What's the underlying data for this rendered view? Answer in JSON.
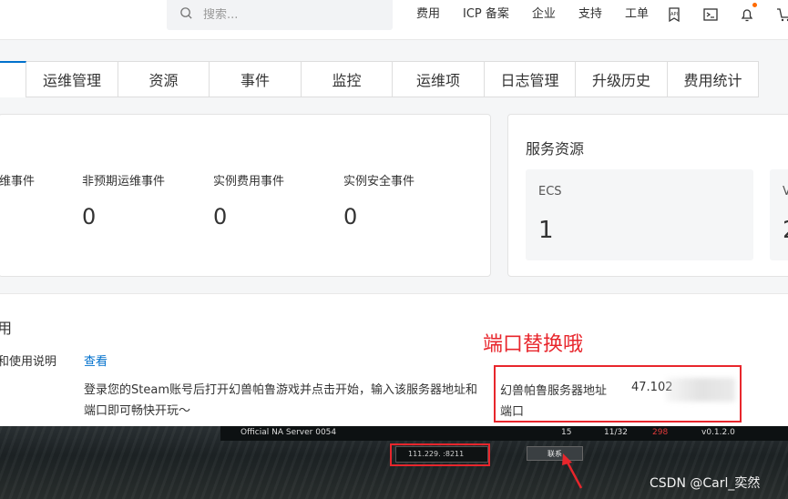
{
  "header": {
    "search_placeholder": "搜索...",
    "nav": [
      "费用",
      "ICP 备案",
      "企业",
      "支持",
      "工单"
    ],
    "icons": [
      "api-icon",
      "terminal-icon",
      "bell-icon",
      "cart-icon"
    ]
  },
  "tabs": [
    "运维管理",
    "资源",
    "事件",
    "监控",
    "运维项",
    "日志管理",
    "升级历史",
    "费用统计"
  ],
  "events": {
    "items": [
      {
        "label": "维事件",
        "value": ""
      },
      {
        "label": "非预期运维事件",
        "value": "0"
      },
      {
        "label": "实例费用事件",
        "value": "0"
      },
      {
        "label": "实例安全事件",
        "value": "0"
      }
    ]
  },
  "resources": {
    "title": "服务资源",
    "boxes": [
      {
        "label": "ECS",
        "value": "1"
      },
      {
        "label": "V",
        "value": "2"
      }
    ]
  },
  "usage": {
    "title": "用",
    "row_label": "和使用说明",
    "link": "查看",
    "link2": "]",
    "description": "登录您的Steam账号后打开幻兽帕鲁游戏并点击开始，输入该服务器地址和端口即可畅快开玩～",
    "address_label": "幻兽帕鲁服务器地址",
    "address_value": "47.102",
    "port_label": "端口"
  },
  "annotation": "端口替换哦",
  "game": {
    "server_name": "Official NA Server 0054",
    "ping": "15",
    "players": "11/32",
    "red_value": "298",
    "version": "v0.1.2.0",
    "ip_text": "111.229.     :8211",
    "connect_label": "联系"
  },
  "watermark": "CSDN @Carl_奕然",
  "colors": {
    "accent": "#0070cc",
    "annotation_red": "#e8262c",
    "notify_dot": "#ff6a00"
  }
}
